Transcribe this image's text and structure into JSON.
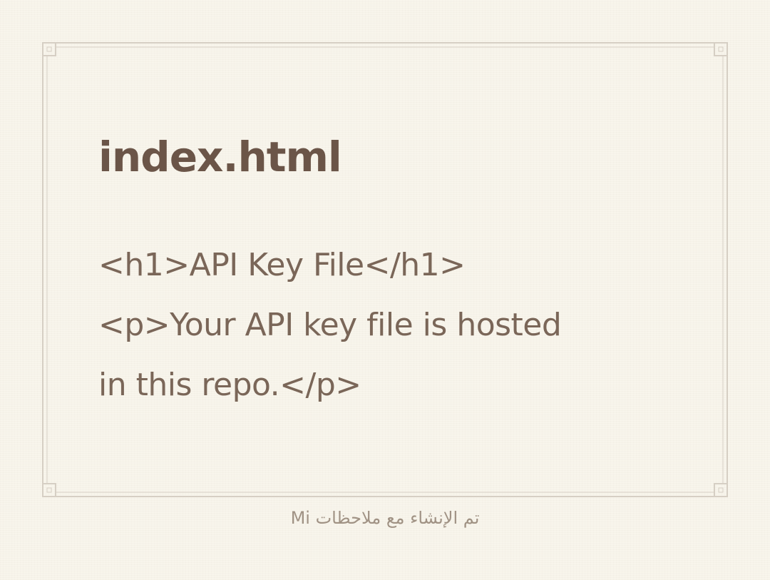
{
  "note": {
    "title": "index.html",
    "body_lines": [
      "<h1>API Key File</h1>",
      "<p>Your API key file is hosted",
      "in this repo.</p>"
    ]
  },
  "footer": {
    "text": "تم الإنشاء مع ملاحظات Mi"
  },
  "colors": {
    "background": "#f8f5ec",
    "border": "#d6cfc4",
    "title": "#6b5548",
    "body": "#7a6658",
    "footer": "#a09284"
  }
}
